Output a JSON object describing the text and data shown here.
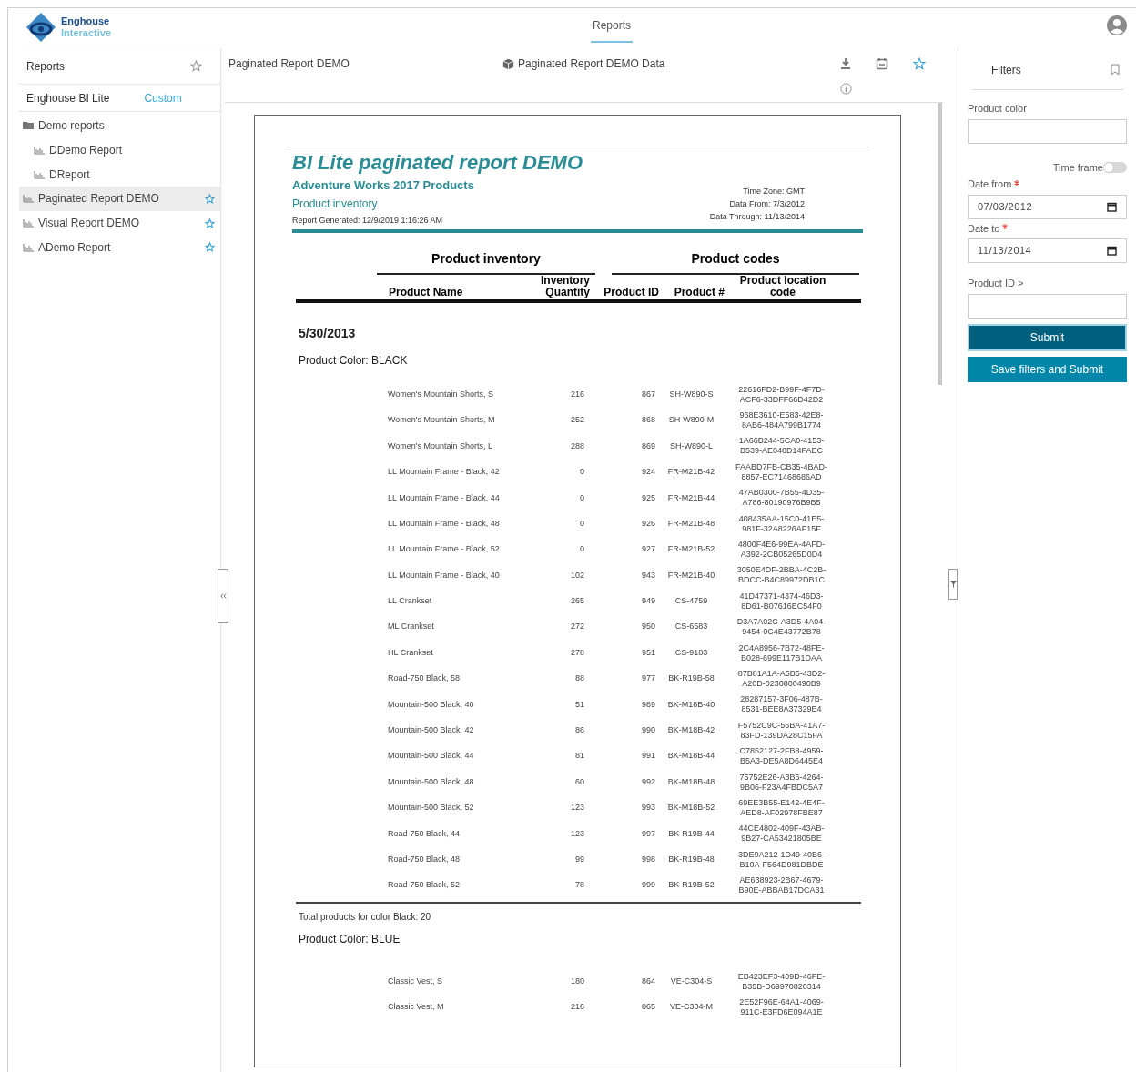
{
  "header": {
    "logo": {
      "line1": "Enghouse",
      "line2": "Interactive"
    },
    "tabs": [
      {
        "label": "Reports",
        "selected": true
      }
    ]
  },
  "sidebar": {
    "title": "Reports",
    "tabs": [
      {
        "label": "Enghouse BI Lite",
        "selected": true
      },
      {
        "label": "Custom",
        "selected": false
      }
    ],
    "items": [
      {
        "kind": "folder",
        "label": "Demo reports",
        "selected": false,
        "children": [
          {
            "kind": "report",
            "label": "DDemo Report",
            "selected": false
          },
          {
            "kind": "report",
            "label": "DReport",
            "selected": false
          }
        ]
      },
      {
        "kind": "report",
        "label": "Paginated Report DEMO",
        "selected": true,
        "favorite": true
      },
      {
        "kind": "report",
        "label": "Visual Report DEMO",
        "selected": false,
        "favorite": true
      },
      {
        "kind": "report",
        "label": "ADemo Report",
        "selected": false,
        "favorite": true
      }
    ]
  },
  "toolbar": {
    "title": "Paginated Report DEMO",
    "data_source": "Paginated Report DEMO Data"
  },
  "report": {
    "title": "BI Lite paginated report DEMO",
    "subtitle": "Adventure Works 2017 Products",
    "section": "Product inventory",
    "generated": "Report Generated: 12/9/2019 1:16:26 AM",
    "meta": [
      {
        "label": "Time Zone:",
        "value": "GMT"
      },
      {
        "label": "Data From:",
        "value": "7/3/2012"
      },
      {
        "label": "Data Through:",
        "value": "11/13/2014"
      }
    ],
    "group_headers": [
      "Product inventory",
      "Product codes"
    ],
    "columns": [
      "Product Name",
      "Inventory Quantity",
      "Product ID",
      "Product #",
      "Product location code"
    ],
    "date": "5/30/2013",
    "groups": [
      {
        "label": "Product Color:",
        "value": "BLACK",
        "total": "Total products for color Black: 20",
        "rows": [
          [
            "Women's Mountain Shorts, S",
            "216",
            "867",
            "SH-W890-S",
            "22616FD2-B99F-4F7D-ACF6-33DFF66D42D2"
          ],
          [
            "Women's Mountain Shorts, M",
            "252",
            "868",
            "SH-W890-M",
            "968E3610-E583-42E8-8AB6-484A799B1774"
          ],
          [
            "Women's Mountain Shorts, L",
            "288",
            "869",
            "SH-W890-L",
            "1A66B244-5CA0-4153-B539-AE048D14FAEC"
          ],
          [
            "LL Mountain Frame - Black, 42",
            "0",
            "924",
            "FR-M21B-42",
            "FAABD7FB-CB35-4BAD-8857-EC71468686AD"
          ],
          [
            "LL Mountain Frame - Black, 44",
            "0",
            "925",
            "FR-M21B-44",
            "47AB0300-7B55-4D35-A786-80190976B9B5"
          ],
          [
            "LL Mountain Frame - Black, 48",
            "0",
            "926",
            "FR-M21B-48",
            "408435AA-15C0-41E5-981F-32A8226AF15F"
          ],
          [
            "LL Mountain Frame - Black, 52",
            "0",
            "927",
            "FR-M21B-52",
            "4800F4E6-99EA-4AFD-A392-2CB05265D0D4"
          ],
          [
            "LL Mountain Frame - Black, 40",
            "102",
            "943",
            "FR-M21B-40",
            "3050E4DF-2BBA-4C2B-BDCC-B4C89972DB1C"
          ],
          [
            "LL Crankset",
            "265",
            "949",
            "CS-4759",
            "41D47371-4374-46D3-8D61-B07616EC54F0"
          ],
          [
            "ML Crankset",
            "272",
            "950",
            "CS-6583",
            "D3A7A02C-A3D5-4A04-9454-0C4E43772B78"
          ],
          [
            "HL Crankset",
            "278",
            "951",
            "CS-9183",
            "2C4A8956-7B72-48FE-B028-699E117B1DAA"
          ],
          [
            "Road-750 Black, 58",
            "88",
            "977",
            "BK-R19B-58",
            "87B81A1A-A5B5-43D2-A20D-0230800490B9"
          ],
          [
            "Mountain-500 Black, 40",
            "51",
            "989",
            "BK-M18B-40",
            "28287157-3F06-487B-8531-BEE8A37329E4"
          ],
          [
            "Mountain-500 Black, 42",
            "86",
            "990",
            "BK-M18B-42",
            "F5752C9C-56BA-41A7-83FD-139DA28C15FA"
          ],
          [
            "Mountain-500 Black, 44",
            "81",
            "991",
            "BK-M18B-44",
            "C7852127-2FB8-4959-B5A3-DE5A8D6445E4"
          ],
          [
            "Mountain-500 Black, 48",
            "60",
            "992",
            "BK-M18B-48",
            "75752E26-A3B6-4264-9B06-F23A4FBDC5A7"
          ],
          [
            "Mountain-500 Black, 52",
            "123",
            "993",
            "BK-M18B-52",
            "69EE3B55-E142-4E4F-AED8-AF02978FBE87"
          ],
          [
            "Road-750 Black, 44",
            "123",
            "997",
            "BK-R19B-44",
            "44CE4802-409F-43AB-9B27-CA53421805BE"
          ],
          [
            "Road-750 Black, 48",
            "99",
            "998",
            "BK-R19B-48",
            "3DE9A212-1D49-40B6-B10A-F564D981DBDE"
          ],
          [
            "Road-750 Black, 52",
            "78",
            "999",
            "BK-R19B-52",
            "AE638923-2B67-4679-B90E-ABBAB17DCA31"
          ]
        ]
      },
      {
        "label": "Product Color:",
        "value": "BLUE",
        "rows": [
          [
            "Classic Vest, S",
            "180",
            "864",
            "VE-C304-S",
            "EB423EF3-409D-46FE-B35B-D69970820314"
          ],
          [
            "Classic Vest, M",
            "216",
            "865",
            "VE-C304-M",
            "2E52F96E-64A1-4069-911C-E3FD6E094A1E"
          ]
        ]
      }
    ]
  },
  "filters": {
    "title": "Filters",
    "fields": [
      {
        "kind": "text",
        "label": "Product color"
      },
      {
        "kind": "toggle",
        "label": "Time frame",
        "on": false
      },
      {
        "kind": "date",
        "label": "Date from",
        "required": true,
        "value": "07/03/2012"
      },
      {
        "kind": "date",
        "label": "Date to",
        "required": true,
        "value": "11/13/2014"
      },
      {
        "kind": "text",
        "label": "Product ID >"
      }
    ],
    "buttons": [
      {
        "kind": "primary",
        "label": "Submit"
      },
      {
        "kind": "secondary",
        "label": "Save filters and Submit"
      }
    ]
  }
}
